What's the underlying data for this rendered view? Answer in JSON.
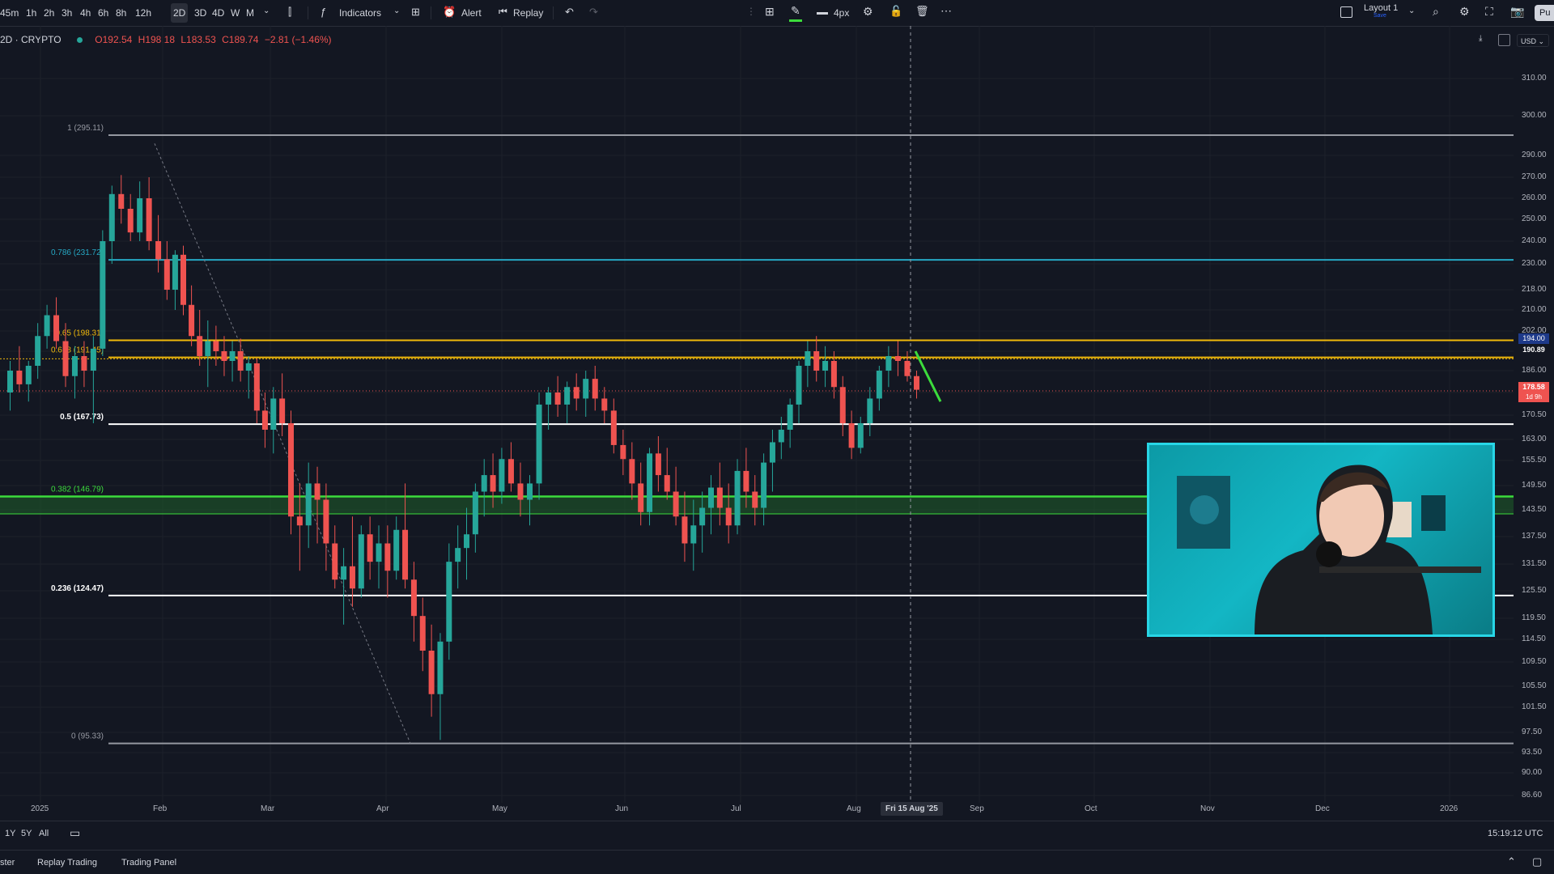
{
  "toolbar": {
    "intervals": [
      "45m",
      "1h",
      "2h",
      "3h",
      "4h",
      "6h",
      "8h",
      "12h",
      "2D",
      "3D",
      "4D",
      "W",
      "M"
    ],
    "selected_interval": "2D",
    "indicators_label": "Indicators",
    "alert_label": "Alert",
    "replay_label": "Replay",
    "line_width_label": "4px",
    "layout_label": "Layout 1",
    "layout_sublabel": "Save",
    "publish_label": "Pu"
  },
  "symbol": {
    "name": "2D · CRYPTO",
    "open": "O192.54",
    "high": "H198.18",
    "low": "L183.53",
    "close": "C189.74",
    "change": "−2.81 (−1.46%)"
  },
  "currency": "USD",
  "price_axis": [
    "310.00",
    "300.00",
    "290.00",
    "270.00",
    "260.00",
    "250.00",
    "240.00",
    "230.00",
    "218.00",
    "210.00",
    "202.00",
    "194.00",
    "186.00",
    "178.00",
    "170.50",
    "163.00",
    "155.50",
    "149.50",
    "143.50",
    "137.50",
    "131.50",
    "125.50",
    "119.50",
    "114.50",
    "109.50",
    "105.50",
    "101.50",
    "97.50",
    "93.50",
    "90.00",
    "86.60"
  ],
  "price_badges": {
    "fib_618": "190.89",
    "current": "178.58",
    "countdown": "1d 9h",
    "fib_level_194": "194.00"
  },
  "time_axis": [
    "2025",
    "Feb",
    "Mar",
    "Apr",
    "May",
    "Jun",
    "Jul",
    "Aug",
    "Sep",
    "Oct",
    "Nov",
    "Dec",
    "2026"
  ],
  "crosshair_date": "Fri 15 Aug '25",
  "fib_levels": [
    {
      "label": "1 (295.11)",
      "price": 295.11,
      "color": "#9598a1"
    },
    {
      "label": "0.786 (231.72)",
      "price": 231.72,
      "color": "#26a8c4"
    },
    {
      "label": "0.65 (198.31)",
      "price": 198.31,
      "color": "#f0b90b"
    },
    {
      "label": "0.618 (191.45)",
      "price": 191.45,
      "color": "#f0b90b"
    },
    {
      "label": "0.5 (167.73)",
      "price": 167.73,
      "color": "#ffffff"
    },
    {
      "label": "0.382 (146.79)",
      "price": 146.79,
      "color": "#3cdc3c"
    },
    {
      "label": "0.236 (124.47)",
      "price": 124.47,
      "color": "#ffffff"
    },
    {
      "label": "0 (95.33)",
      "price": 95.33,
      "color": "#9598a1"
    }
  ],
  "colors": {
    "up": "#26a69a",
    "down": "#ef5350",
    "background": "#131722",
    "accent": "#2962ff",
    "webcam_border": "#28d6e6"
  },
  "bottom": {
    "ranges": [
      "1Y",
      "5Y",
      "All"
    ],
    "clock": "15:19:12 UTC",
    "tabs": [
      "ster",
      "Replay Trading",
      "Trading Panel"
    ]
  },
  "icons": [
    "chart-style-icon",
    "indicators-icon",
    "templates-icon",
    "alert-icon",
    "replay-icon",
    "undo-icon",
    "redo-icon",
    "drawing-color-icon",
    "line-width-icon",
    "settings-icon",
    "lock-icon",
    "trash-icon",
    "more-icon",
    "layout-icon",
    "search-icon",
    "gear-icon",
    "fullscreen-icon",
    "camera-icon",
    "date-range-icon",
    "collapse-icon",
    "maximize-icon"
  ]
}
